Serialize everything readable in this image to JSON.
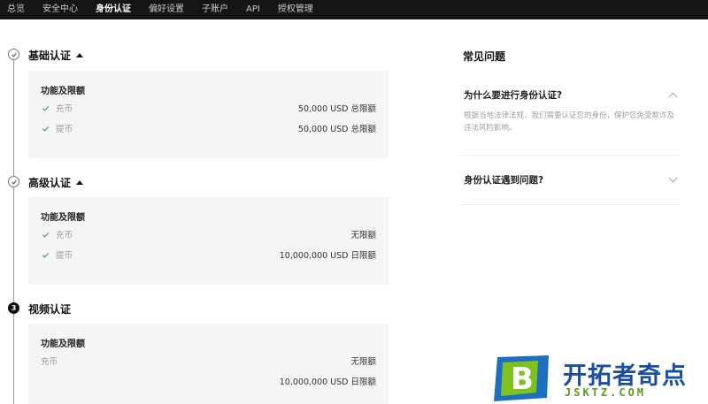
{
  "nav": {
    "items": [
      {
        "label": "总览",
        "active": false
      },
      {
        "label": "安全中心",
        "active": false
      },
      {
        "label": "身份认证",
        "active": true
      },
      {
        "label": "偏好设置",
        "active": false
      },
      {
        "label": "子账户",
        "active": false
      },
      {
        "label": "API",
        "active": false
      },
      {
        "label": "授权管理",
        "active": false
      }
    ]
  },
  "steps": [
    {
      "title": "基础认证",
      "status": "completed",
      "marker": "check-icon",
      "expanded": true,
      "card": {
        "heading": "功能及限额",
        "rows": [
          {
            "label": "充币",
            "value": "50,000 USD 总限额",
            "checked": true
          },
          {
            "label": "提币",
            "value": "50,000 USD 总限额",
            "checked": true
          }
        ]
      }
    },
    {
      "title": "高级认证",
      "status": "completed",
      "marker": "check-icon",
      "expanded": true,
      "card": {
        "heading": "功能及限额",
        "rows": [
          {
            "label": "充币",
            "value": "无限额",
            "checked": true
          },
          {
            "label": "提币",
            "value": "10,000,000 USD 日限额",
            "checked": true
          }
        ]
      }
    },
    {
      "title": "视频认证",
      "status": "current",
      "marker": "3",
      "expanded": true,
      "card": {
        "heading": "功能及限额",
        "rows": [
          {
            "label": "充币",
            "value": "无限额",
            "checked": false
          },
          {
            "label": "",
            "value": "10,000,000 USD 日限额",
            "checked": false
          }
        ]
      }
    }
  ],
  "faq": {
    "title": "常见问题",
    "items": [
      {
        "question": "为什么要进行身份认证?",
        "expanded": true,
        "answer": "根据当地法律法规，我们需要认证您的身份，保护您免受欺诈及违法风险影响。"
      },
      {
        "question": "身份认证遇到问题?",
        "expanded": false,
        "answer": ""
      }
    ]
  },
  "watermark": {
    "logo_letter": "B",
    "name": "开拓者奇点",
    "url": "JSKTZ.COM"
  },
  "colors": {
    "nav_bg": "#151515",
    "card_bg": "#f5f5f5",
    "check_green": "#3fa35a",
    "watermark_blue": "#1a4fa0",
    "watermark_green": "#5a9a1e"
  }
}
